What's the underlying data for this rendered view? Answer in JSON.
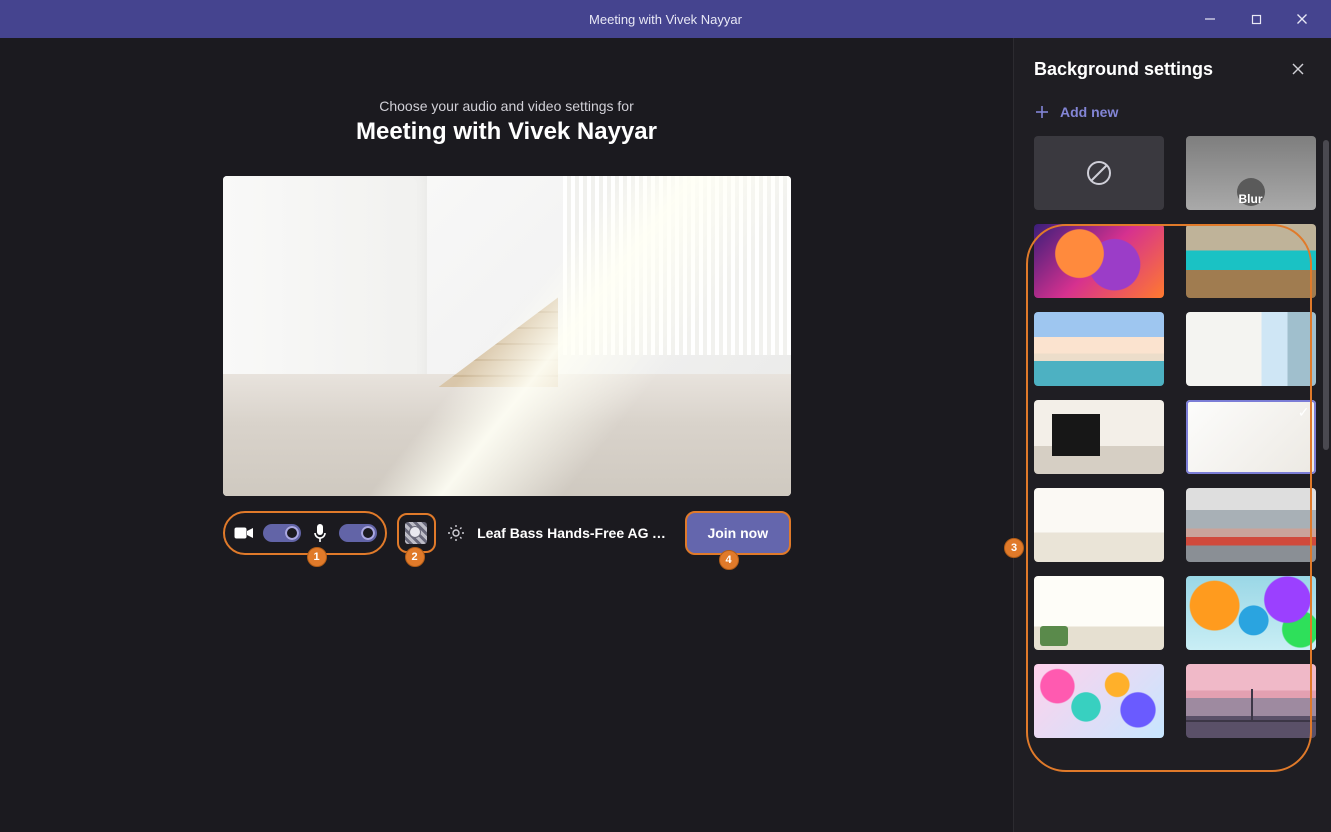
{
  "window": {
    "title": "Meeting with Vivek Nayyar"
  },
  "main": {
    "subtitle": "Choose your audio and video settings for",
    "meeting_title": "Meeting with Vivek Nayyar",
    "device_label": "Leaf Bass Hands-Free AG Au…",
    "join_label": "Join now",
    "badges": {
      "one": "1",
      "two": "2",
      "three": "3",
      "four": "4"
    }
  },
  "panel": {
    "title": "Background settings",
    "add_new": "Add new",
    "blur_label": "Blur"
  }
}
